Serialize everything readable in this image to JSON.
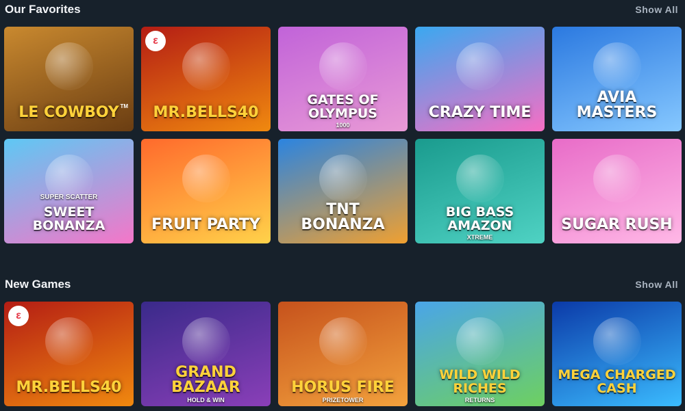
{
  "favorites": {
    "title": "Our Favorites",
    "show_all": "Show All",
    "games": [
      {
        "title": "Le Cowboy",
        "tm": "TM",
        "icon": "cowboy-raccoon-icon",
        "colors": [
          "#c9892f",
          "#6a3d12"
        ],
        "label_color": "gold"
      },
      {
        "title": "Mr.Bells40",
        "icon": "bell-character-icon",
        "provider_badge": "ε",
        "colors": [
          "#b41d14",
          "#f0890f"
        ],
        "label_color": "gold"
      },
      {
        "title": "Gates of Olympus",
        "sub": "1000",
        "icon": "zeus-icon",
        "colors": [
          "#c163d9",
          "#e99ad6"
        ],
        "label_color": "white"
      },
      {
        "title": "Crazy Time",
        "icon": "presenter-wheel-icon",
        "colors": [
          "#3aa8f0",
          "#f76ec4"
        ],
        "label_color": "white"
      },
      {
        "title": "Avia Masters",
        "icon": "red-plane-icon",
        "colors": [
          "#2b79e0",
          "#86c8ff"
        ],
        "label_color": "white"
      },
      {
        "title": "Sweet Bonanza",
        "sup": "Super Scatter",
        "icon": "candy-lollipop-icon",
        "colors": [
          "#5ec8f4",
          "#f576c8"
        ],
        "label_color": "white"
      },
      {
        "title": "Fruit Party",
        "icon": "peach-fruit-icon",
        "colors": [
          "#ff6a2c",
          "#ffd24a"
        ],
        "label_color": "white"
      },
      {
        "title": "TNT Bonanza",
        "icon": "bomb-icon",
        "colors": [
          "#2b84e0",
          "#f0a030"
        ],
        "label_color": "white"
      },
      {
        "title": "Big Bass Amazon",
        "sub": "Xtreme",
        "icon": "explorer-fisherman-icon",
        "colors": [
          "#1a9b8e",
          "#4fd2c3"
        ],
        "label_color": "white"
      },
      {
        "title": "Sugar Rush",
        "icon": "gumball-machine-icon",
        "colors": [
          "#e86cc8",
          "#ffb8e6"
        ],
        "label_color": "white"
      }
    ]
  },
  "new_games": {
    "title": "New Games",
    "show_all": "Show All",
    "games": [
      {
        "title": "Mr.Bells40",
        "icon": "bell-character-icon",
        "provider_badge": "ε",
        "colors": [
          "#b41d14",
          "#f0890f"
        ],
        "label_color": "gold"
      },
      {
        "title": "Grand Bazaar",
        "sub": "Hold & Win",
        "icon": "golden-lamp-icon",
        "colors": [
          "#3a2a8a",
          "#8a3fb8"
        ],
        "label_color": "gold"
      },
      {
        "title": "Horus Fire",
        "sub": "PrizeTower",
        "icon": "horus-falcon-icon",
        "colors": [
          "#c6521c",
          "#f3a23d"
        ],
        "label_color": "gold"
      },
      {
        "title": "Wild Wild Riches",
        "sub": "Returns",
        "icon": "pot-of-gold-icon",
        "colors": [
          "#4aa5e8",
          "#6ed060"
        ],
        "label_color": "gold"
      },
      {
        "title": "Mega Charged Cash",
        "icon": "lightning-icon",
        "colors": [
          "#0b3aa8",
          "#3bbcff"
        ],
        "label_color": "gold"
      }
    ]
  }
}
